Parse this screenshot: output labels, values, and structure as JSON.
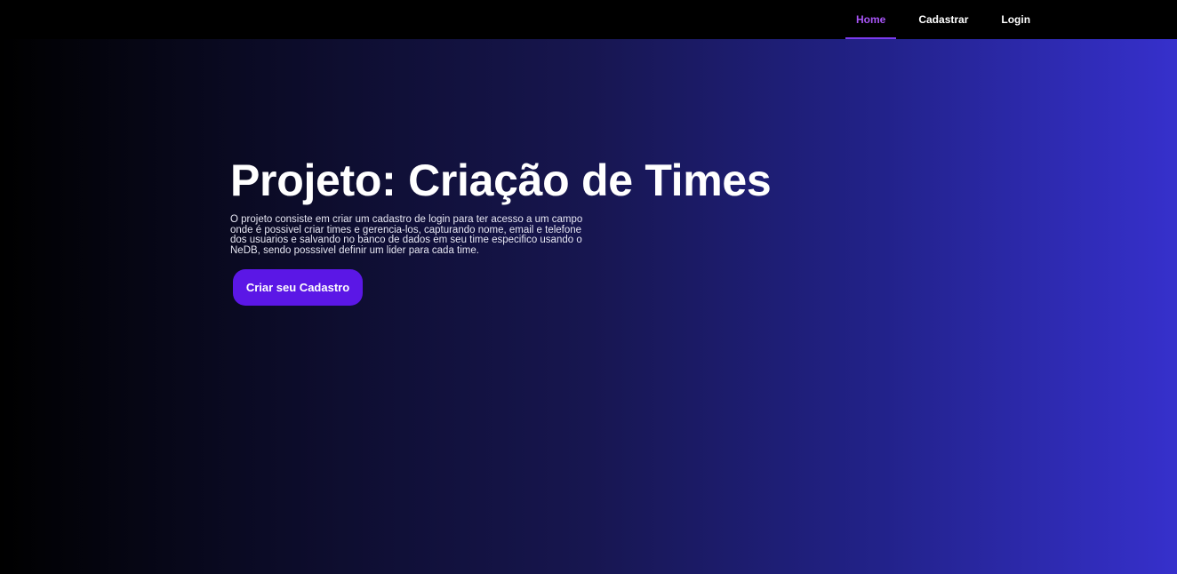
{
  "nav": {
    "items": [
      {
        "label": "Home",
        "active": true
      },
      {
        "label": "Cadastrar",
        "active": false
      },
      {
        "label": "Login",
        "active": false
      }
    ]
  },
  "hero": {
    "title": "Projeto: Criação de Times",
    "description": "O projeto consiste em criar um cadastro de login para ter acesso a um campo onde é possivel criar times e gerencia-los, capturando nome, email e telefone dos usuarios e salvando no banco de dados em seu time especifico usando o NeDB, sendo posssivel definir um lider para cada time.",
    "cta_label": "Criar seu Cadastro"
  },
  "colors": {
    "accent": "#a855f7",
    "button": "#5b17e6",
    "gradient_start": "#000000",
    "gradient_end": "#3630cc"
  }
}
